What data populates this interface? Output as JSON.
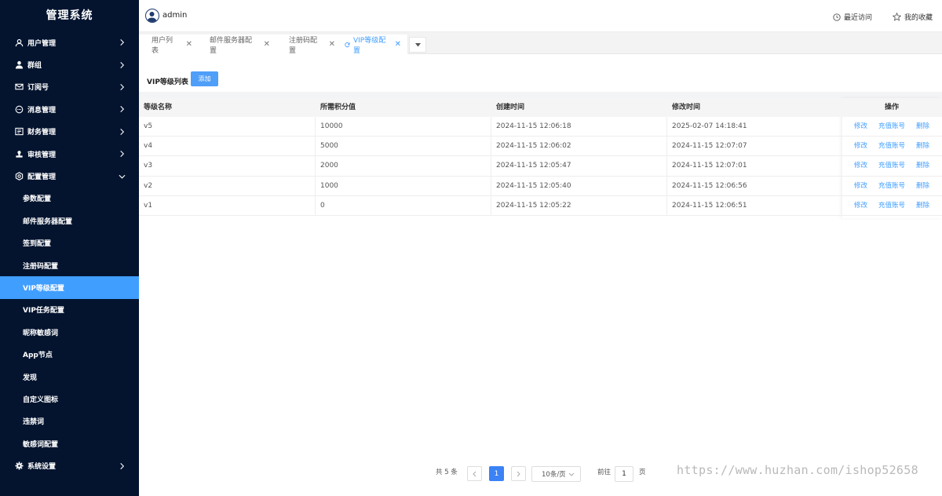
{
  "sidebar": {
    "brand": "管理系统",
    "menu": [
      {
        "label": "用户管理",
        "icon": "user-icon"
      },
      {
        "label": "群组",
        "icon": "person-icon"
      },
      {
        "label": "订阅号",
        "icon": "mail-icon"
      },
      {
        "label": "消息管理",
        "icon": "chat-icon"
      },
      {
        "label": "财务管理",
        "icon": "finance-icon"
      },
      {
        "label": "审核管理",
        "icon": "stamp-icon"
      },
      {
        "label": "配置管理",
        "icon": "settings-icon"
      }
    ],
    "submenu": [
      "参数配置",
      "邮件服务器配置",
      "签到配置",
      "注册码配置",
      "VIP等级配置",
      "VIP任务配置",
      "昵称敏感词",
      "App节点",
      "发现",
      "自定义图标",
      "违禁词",
      "敏感词配置"
    ],
    "bottom_item": {
      "label": "系统设置",
      "icon": "gear-icon"
    }
  },
  "header": {
    "username": "admin",
    "recent": "最近访问",
    "favorites": "我的收藏"
  },
  "tabs": [
    "用户列表",
    "邮件服务器配置",
    "注册码配置",
    "VIP等级配置"
  ],
  "content": {
    "list_title": "VIP等级列表",
    "add_button": "添加"
  },
  "table": {
    "headers": [
      "等级名称",
      "所需积分值",
      "创建时间",
      "修改时间",
      "操作"
    ],
    "rows": [
      [
        "v5",
        "10000",
        "2024-11-15 12:06:18",
        "2025-02-07 14:18:41"
      ],
      [
        "v4",
        "5000",
        "2024-11-15 12:06:02",
        "2024-11-15 12:07:07"
      ],
      [
        "v3",
        "2000",
        "2024-11-15 12:05:47",
        "2024-11-15 12:07:01"
      ],
      [
        "v2",
        "1000",
        "2024-11-15 12:05:40",
        "2024-11-15 12:06:56"
      ],
      [
        "v1",
        "0",
        "2024-11-15 12:05:22",
        "2024-11-15 12:06:51"
      ]
    ],
    "actions": [
      "修改",
      "充值账号",
      "删除"
    ]
  },
  "pagination": {
    "total": "共 5 条",
    "current_page": "1",
    "page_size": "10条/页",
    "goto_label": "前往",
    "goto_value": "1",
    "page_suffix": "页"
  },
  "watermark": "https://www.huzhan.com/ishop52658",
  "colors": {
    "sidebar_bg": "#04142f",
    "accent": "#409eff"
  }
}
